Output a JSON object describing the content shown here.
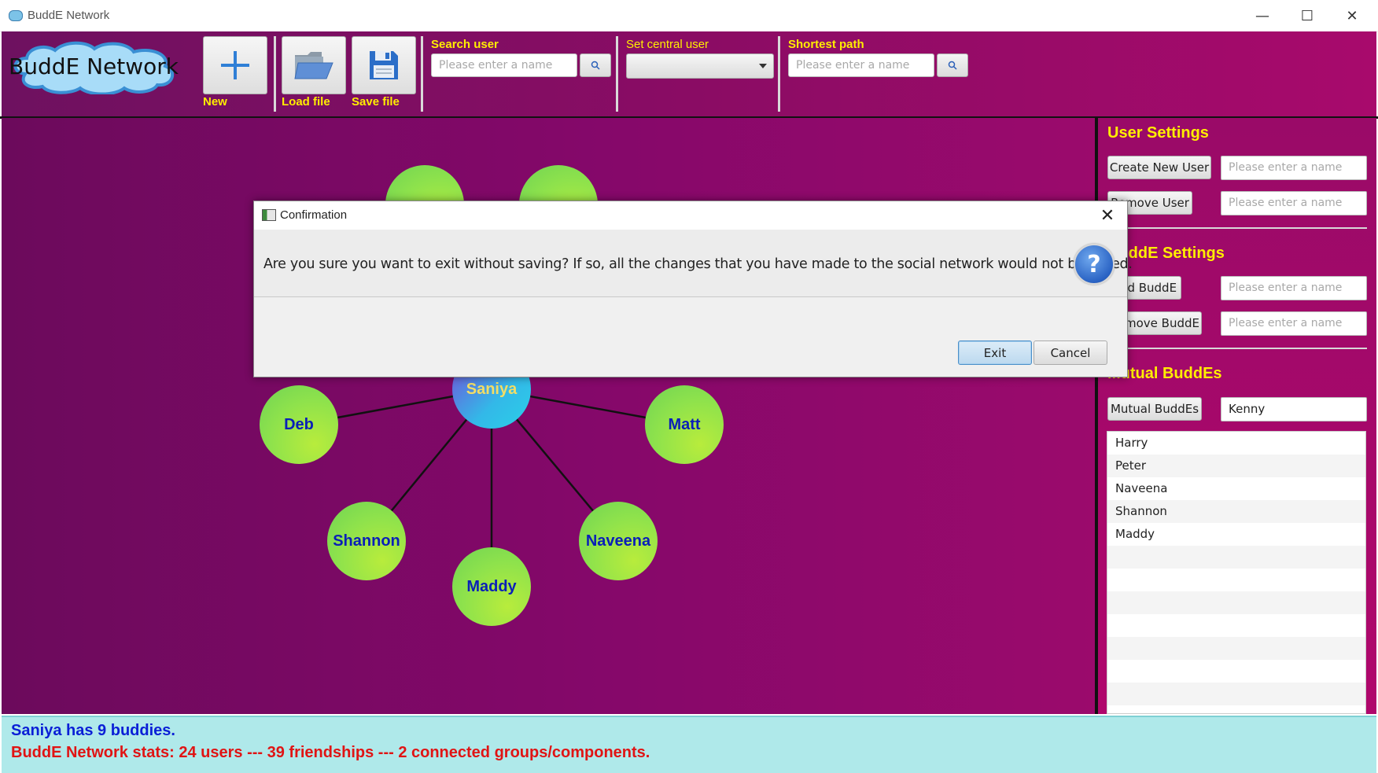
{
  "window": {
    "title": "BuddE Network",
    "minimize_glyph": "—",
    "maximize_glyph": "☐",
    "close_glyph": "✕"
  },
  "toolbar": {
    "logo_text": "BuddE Network",
    "new_label": "New",
    "load_label": "Load file",
    "save_label": "Save file",
    "search_user": {
      "label": "Search user",
      "placeholder": "Please enter a name"
    },
    "central_user": {
      "label": "Set central user",
      "value": ""
    },
    "shortest_path": {
      "label": "Shortest path",
      "placeholder": "Please enter a name"
    }
  },
  "graph": {
    "central": "Saniya",
    "nodes": [
      "Deb",
      "Matt",
      "Shannon",
      "Maddy",
      "Naveena"
    ]
  },
  "right_panel": {
    "user_settings": {
      "title": "User Settings",
      "create_label": "Create New User",
      "create_placeholder": "Please enter a name",
      "remove_label": "Remove User",
      "remove_placeholder": "Please enter a name"
    },
    "budde_settings": {
      "title": "BuddE Settings",
      "add_label": "Add BuddE",
      "add_placeholder": "Please enter a name",
      "remove_label": "Remove BuddE",
      "remove_placeholder": "Please enter a name"
    },
    "mutual": {
      "title": "Mutual BuddEs",
      "button_label": "Mutual BuddEs",
      "input_value": "Kenny",
      "list": [
        "Harry",
        "Peter",
        "Naveena",
        "Shannon",
        "Maddy",
        "",
        "",
        "",
        "",
        "",
        "",
        ""
      ]
    }
  },
  "status": {
    "line1": "Saniya has 9 buddies.",
    "line2": "BuddE Network stats: 24 users --- 39 friendships --- 2 connected groups/components."
  },
  "dialog": {
    "title": "Confirmation",
    "message": "Are you sure you want to exit without saving? If so, all the changes that you have made to the social network would not be saved.",
    "question_glyph": "?",
    "close_glyph": "✕",
    "exit_label": "Exit",
    "cancel_label": "Cancel"
  },
  "colors": {
    "accent_yellow": "#ffee00",
    "node_text": "#0a1fb8",
    "status_blue": "#0a1fd6",
    "status_red": "#e01414"
  }
}
